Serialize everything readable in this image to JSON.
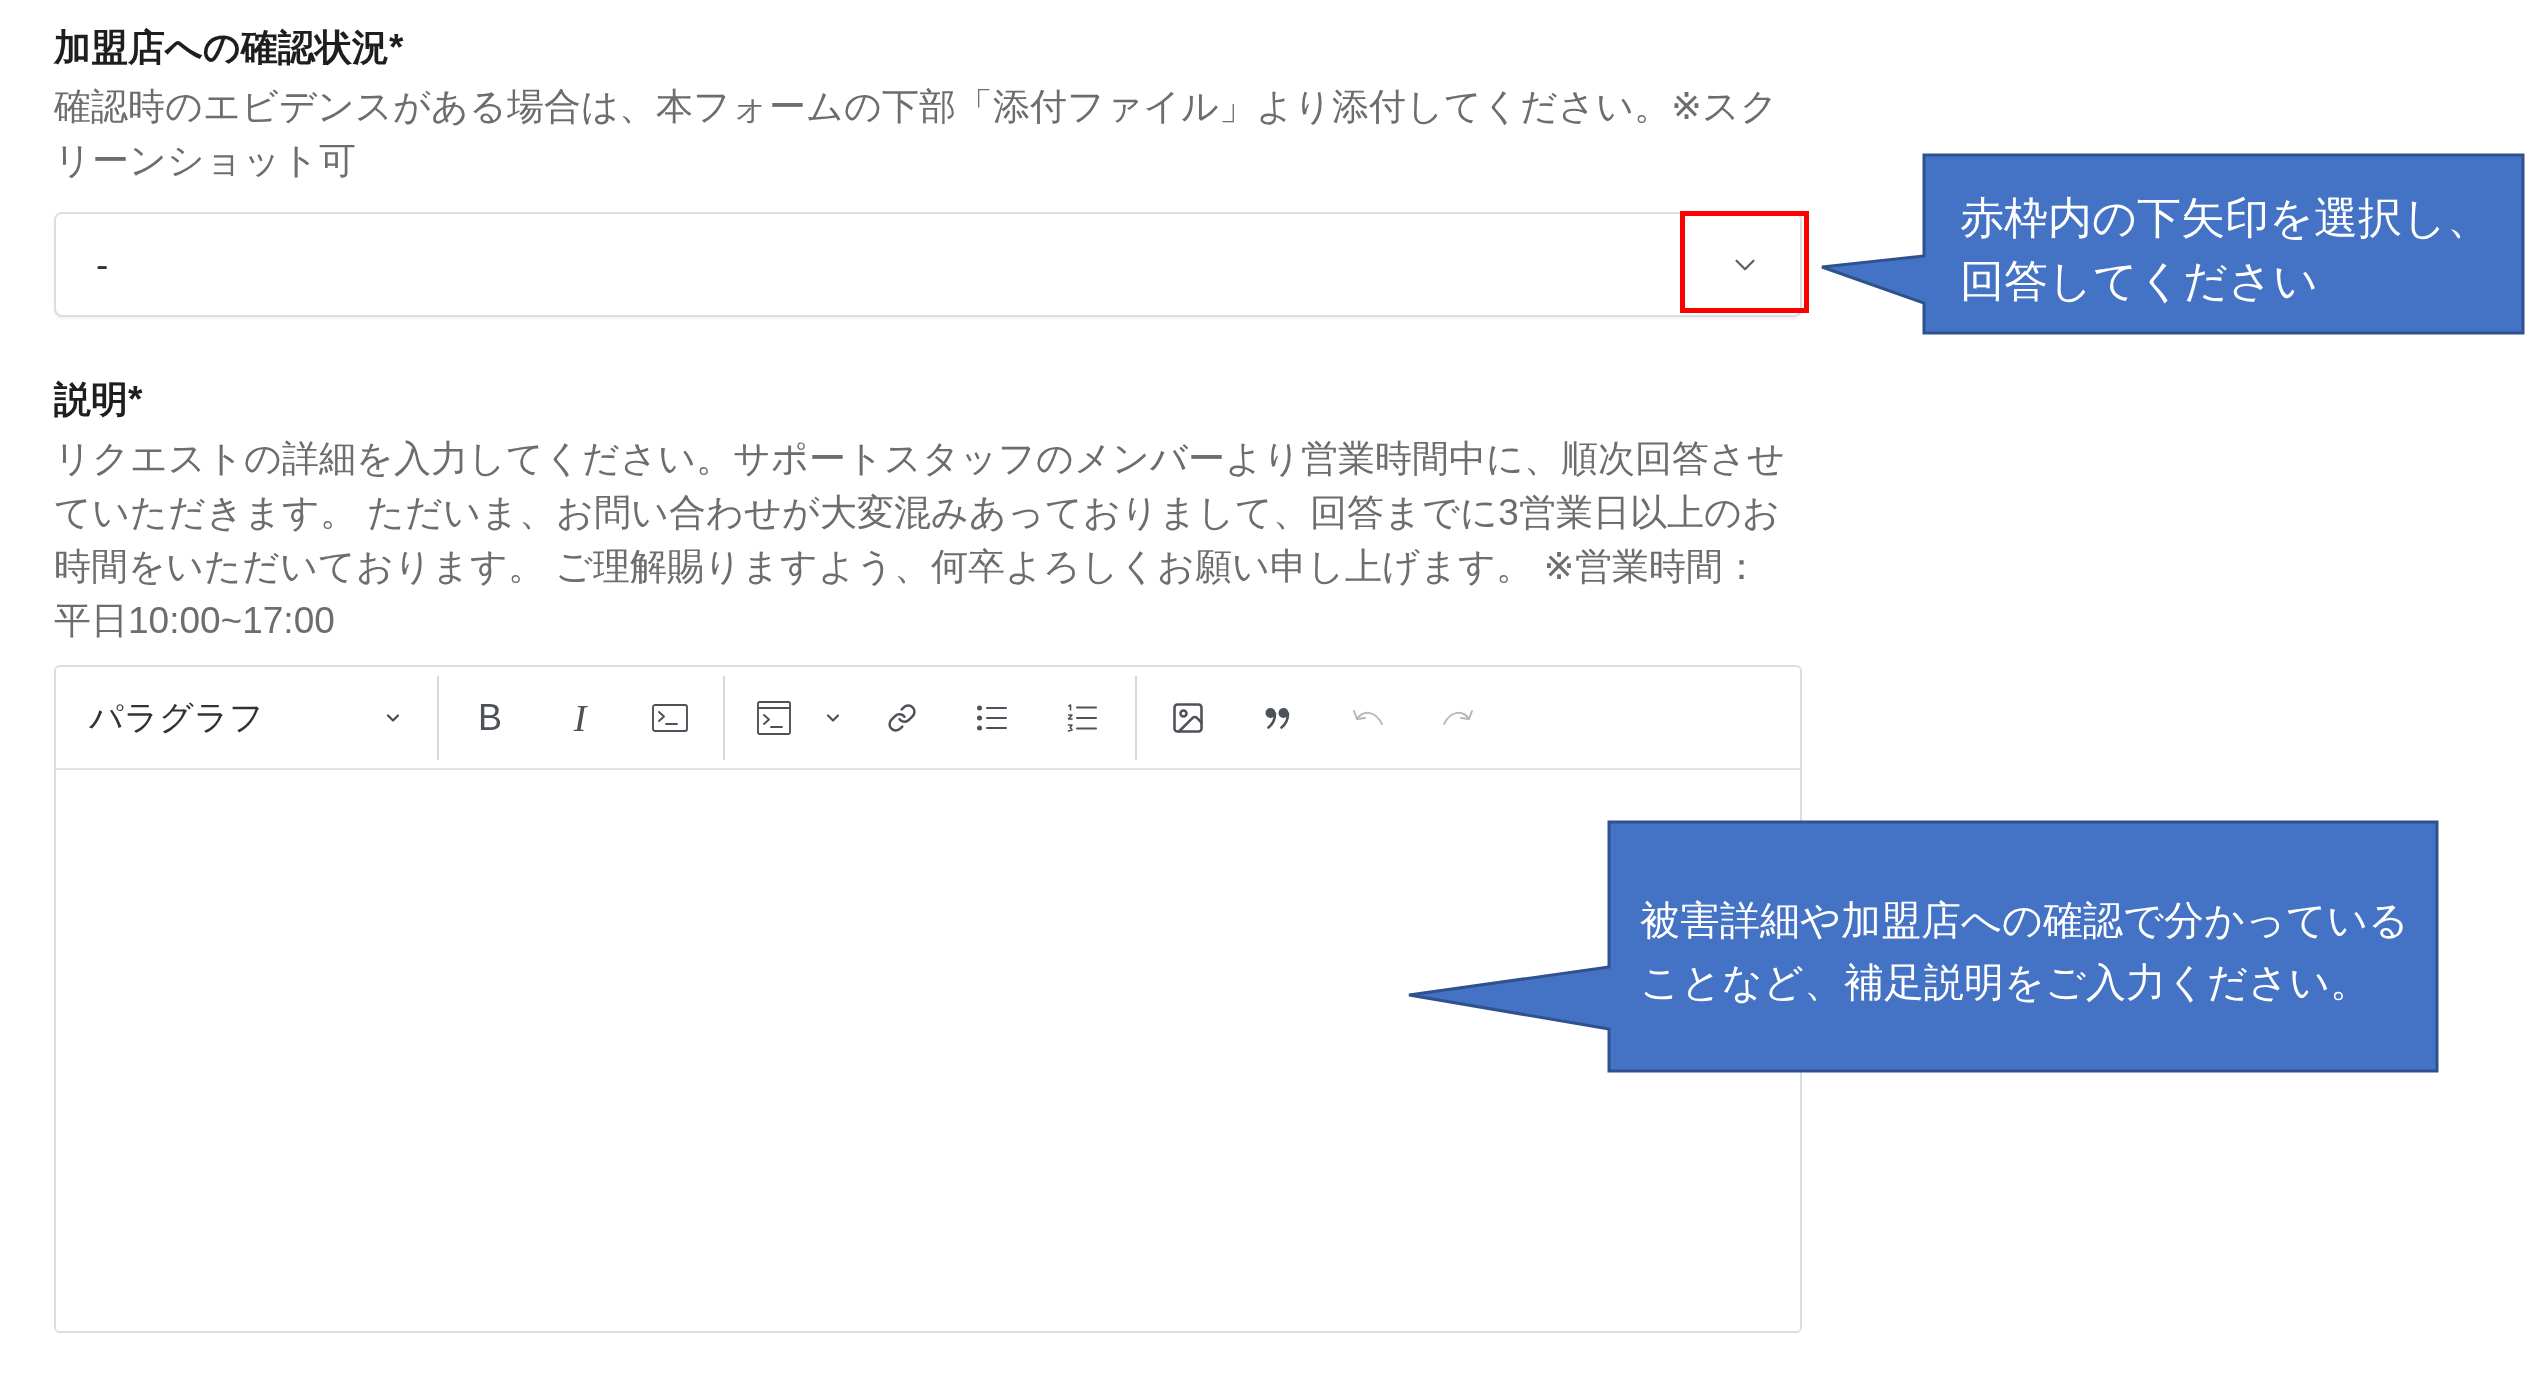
{
  "fields": [
    {
      "kind": "select",
      "label": "加盟店への確認状況*",
      "description": "確認時のエビデンスがある場合は、本フォームの下部「添付ファイル」より添付してください。※スクリーンショット可",
      "value": "-",
      "highlighted": true
    },
    {
      "kind": "rich_text",
      "label": "説明*",
      "description": "リクエストの詳細を入力してください。サポートスタッフのメンバーより営業時間中に、順次回答させていただきます。 ただいま、お問い合わせが大変混みあっておりまして、回答までに3営業日以上のお時間をいただいております。 ご理解賜りますよう、何卒よろしくお願い申し上げます。 ※営業時間：平日10:00~17:00",
      "toolbar": {
        "format": "パラグラフ",
        "groups": [
          [
            {
              "kind": "bold",
              "glyph": "B",
              "disabled": false
            },
            {
              "kind": "italic",
              "glyph": "I",
              "disabled": false
            },
            {
              "kind": "code",
              "disabled": false
            }
          ],
          [
            {
              "kind": "code_block",
              "menu": true,
              "disabled": false
            },
            {
              "kind": "link",
              "disabled": false
            },
            {
              "kind": "bullet_list",
              "disabled": false
            },
            {
              "kind": "numbered_list",
              "disabled": false
            }
          ],
          [
            {
              "kind": "image",
              "disabled": false
            },
            {
              "kind": "quote",
              "disabled": false
            },
            {
              "kind": "undo",
              "disabled": true
            },
            {
              "kind": "redo",
              "disabled": true
            }
          ]
        ]
      }
    }
  ],
  "callouts": [
    {
      "text": "赤枠内の下矢印を選択し、回答してください"
    },
    {
      "text": "被害詳細や加盟店への確認で分かっていることなど、補足説明をご入力ください。"
    }
  ]
}
